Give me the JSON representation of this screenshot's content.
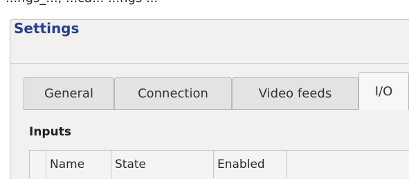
{
  "window": {
    "partial_title": "...ngs_..., ...ca... ...ngs ..."
  },
  "dialog": {
    "title": "Settings"
  },
  "tabs": [
    {
      "label": "General",
      "active": false
    },
    {
      "label": "Connection",
      "active": false
    },
    {
      "label": "Video feeds",
      "active": false
    },
    {
      "label": "I/O",
      "active": true
    }
  ],
  "inputs": {
    "section_label": "Inputs",
    "columns": [
      "",
      "Name",
      "State",
      "Enabled",
      ""
    ]
  },
  "colors": {
    "title_blue": "#25408f",
    "dialog_bg": "#f2f1f0",
    "tab_bg": "#e4e3e1",
    "active_tab_bg": "#f7f7f7"
  }
}
